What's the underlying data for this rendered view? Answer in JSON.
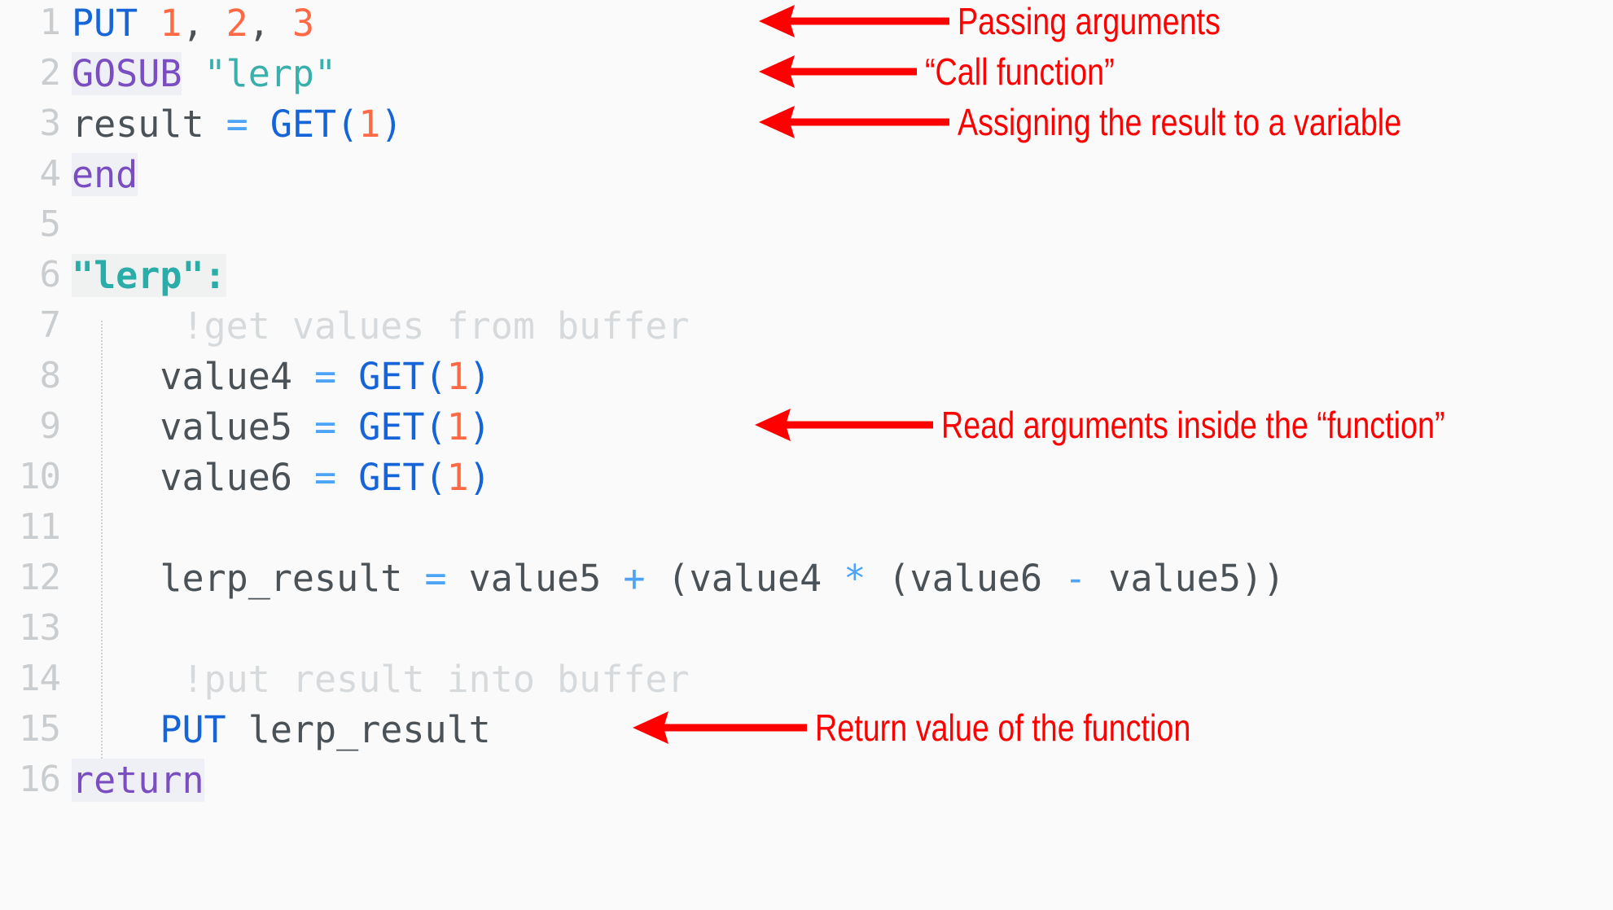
{
  "editor": {
    "language_hint": "BASIC-like script",
    "background_color": "#fafafa",
    "gutter_color": "#c9cdd0",
    "lines": [
      {
        "number": "1",
        "text": "PUT 1, 2, 3"
      },
      {
        "number": "2",
        "text": "GOSUB \"lerp\""
      },
      {
        "number": "3",
        "text": "result = GET(1)"
      },
      {
        "number": "4",
        "text": "end"
      },
      {
        "number": "5",
        "text": ""
      },
      {
        "number": "6",
        "text": "\"lerp\":"
      },
      {
        "number": "7",
        "text": "    !get values from buffer"
      },
      {
        "number": "8",
        "text": "    value4 = GET(1)"
      },
      {
        "number": "9",
        "text": "    value5 = GET(1)"
      },
      {
        "number": "10",
        "text": "    value6 = GET(1)"
      },
      {
        "number": "11",
        "text": ""
      },
      {
        "number": "12",
        "text": "    lerp_result = value5 + (value4 * (value6 - value5))"
      },
      {
        "number": "13",
        "text": ""
      },
      {
        "number": "14",
        "text": "    !put result into buffer"
      },
      {
        "number": "15",
        "text": "    PUT lerp_result"
      },
      {
        "number": "16",
        "text": "return"
      }
    ],
    "tokens": {
      "put_keyword": "PUT",
      "gosub_keyword": "GOSUB",
      "end_keyword": "end",
      "return_keyword": "return",
      "get_function": "GET",
      "string_lerp": "\"lerp\"",
      "label_lerp": "\"lerp\":",
      "number_one": "1",
      "number_two": "2",
      "number_three": "3",
      "var_result": "result",
      "var_value4": "value4",
      "var_value5": "value5",
      "var_value6": "value6",
      "var_lerp_result": "lerp_result",
      "comment_get": "!get values from buffer",
      "comment_put": "!put result into buffer",
      "op_assign": "=",
      "op_plus": "+",
      "op_mul": "*",
      "op_minus": "-",
      "comma": ",",
      "paren_open": "(",
      "paren_close": ")"
    },
    "syntax_colors": {
      "keyword_blue": "#1565d8",
      "keyword_purple": "#7a4ec0",
      "number": "#ff6a45",
      "string": "#3ab0ac",
      "label": "#2aaca8",
      "operator": "#4da3f5",
      "identifier": "#4a5257",
      "comment": "#d7dadc",
      "gutter": "#c9cdd0"
    }
  },
  "annotations": {
    "color": "#ff0000",
    "items": [
      {
        "id": "passing-arguments",
        "label": "Passing arguments",
        "target_line": "1"
      },
      {
        "id": "call-function",
        "label": "“Call function”",
        "target_line": "2"
      },
      {
        "id": "assigning-result",
        "label": "Assigning the result to a variable",
        "target_line": "3"
      },
      {
        "id": "read-arguments",
        "label": "Read arguments inside the “function”",
        "target_line": "9"
      },
      {
        "id": "return-value",
        "label": "Return value of the function",
        "target_line": "15"
      }
    ]
  }
}
